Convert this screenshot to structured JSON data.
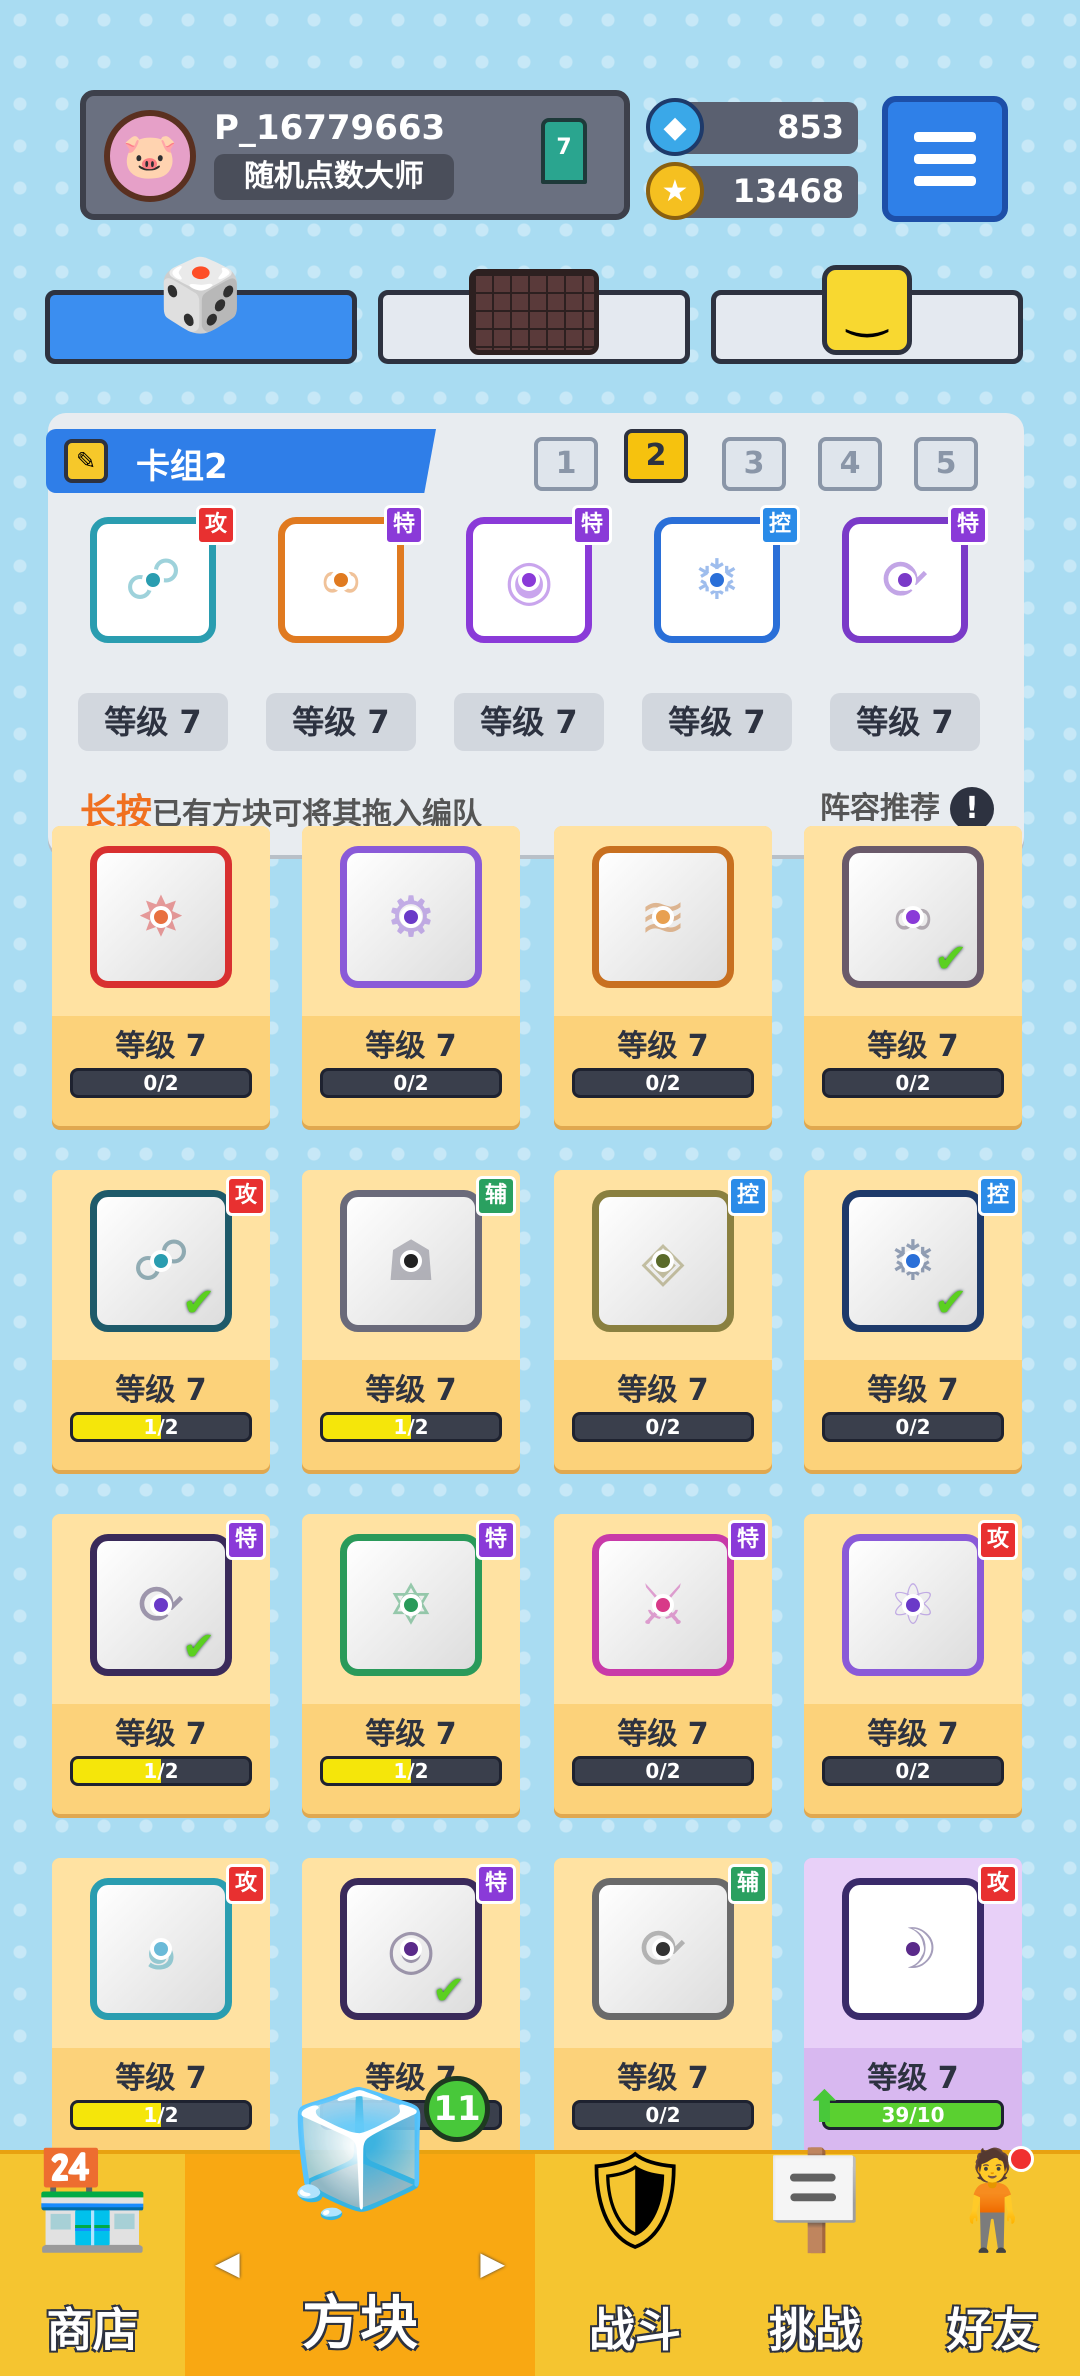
{
  "profile": {
    "name": "P_16779663",
    "title": "随机点数大师",
    "rank": "7"
  },
  "currency": {
    "gems": "853",
    "coins": "13468"
  },
  "deck": {
    "title": "卡组2",
    "numbers": [
      "1",
      "2",
      "3",
      "4",
      "5"
    ],
    "active_index": 1,
    "cards": [
      {
        "tag": "攻",
        "level": "等级 7",
        "color": "#2a9db0",
        "tag_color": "#e83030",
        "sym": "☍"
      },
      {
        "tag": "特",
        "level": "等级 7",
        "color": "#e07a20",
        "tag_color": "#8a3ad8",
        "sym": "∞"
      },
      {
        "tag": "特",
        "level": "等级 7",
        "color": "#8a3ad8",
        "tag_color": "#8a3ad8",
        "sym": "◉"
      },
      {
        "tag": "控",
        "level": "等级 7",
        "color": "#2a6fd8",
        "tag_color": "#2a8be8",
        "sym": "❄"
      },
      {
        "tag": "特",
        "level": "等级 7",
        "color": "#7a3ac8",
        "tag_color": "#8a3ad8",
        "sym": "⟳"
      }
    ],
    "hint_em": "长按",
    "hint_rest": "已有方块可将其拖入编队",
    "recommend": "阵容推荐",
    "recommend_icon": "!"
  },
  "grid": [
    {
      "level": "等级 7",
      "progress": "0/2",
      "ratio": 0,
      "color": "#d83030",
      "tag": "",
      "check": false,
      "sym": "✸",
      "dot": "#e87040"
    },
    {
      "level": "等级 7",
      "progress": "0/2",
      "ratio": 0,
      "color": "#8a5ad8",
      "tag": "",
      "check": false,
      "sym": "⚙",
      "dot": "#6a3ac8"
    },
    {
      "level": "等级 7",
      "progress": "0/2",
      "ratio": 0,
      "color": "#c87020",
      "tag": "",
      "check": false,
      "sym": "≋",
      "dot": "#e8a050"
    },
    {
      "level": "等级 7",
      "progress": "0/2",
      "ratio": 0,
      "color": "#6a5a6a",
      "tag": "",
      "check": true,
      "sym": "∞",
      "dot": "#8a3ad8"
    },
    {
      "level": "等级 7",
      "progress": "1/2",
      "ratio": 0.5,
      "color": "#1e5a6a",
      "tag": "攻",
      "tag_color": "#e83030",
      "check": true,
      "sym": "☍",
      "dot": "#2a9db0"
    },
    {
      "level": "等级 7",
      "progress": "1/2",
      "ratio": 0.5,
      "color": "#6a6a7a",
      "tag": "辅",
      "tag_color": "#2aa060",
      "check": false,
      "sym": "☗",
      "dot": "#222"
    },
    {
      "level": "等级 7",
      "progress": "0/2",
      "ratio": 0,
      "color": "#8a8040",
      "tag": "控",
      "tag_color": "#2a8be8",
      "check": false,
      "sym": "◈",
      "dot": "#5a6a2a"
    },
    {
      "level": "等级 7",
      "progress": "0/2",
      "ratio": 0,
      "color": "#1e3a6a",
      "tag": "控",
      "tag_color": "#2a8be8",
      "check": true,
      "sym": "❄",
      "dot": "#2a6fd8"
    },
    {
      "level": "等级 7",
      "progress": "1/2",
      "ratio": 0.5,
      "color": "#3a2a5a",
      "tag": "特",
      "tag_color": "#8a3ad8",
      "check": true,
      "sym": "⟳",
      "dot": "#6a3ac8"
    },
    {
      "level": "等级 7",
      "progress": "1/2",
      "ratio": 0.5,
      "color": "#2a9a5a",
      "tag": "特",
      "tag_color": "#8a3ad8",
      "check": false,
      "sym": "✡",
      "dot": "#2a9a5a"
    },
    {
      "level": "等级 7",
      "progress": "0/2",
      "ratio": 0,
      "color": "#c83aa8",
      "tag": "特",
      "tag_color": "#8a3ad8",
      "check": false,
      "sym": "⚔",
      "dot": "#d83a88"
    },
    {
      "level": "等级 7",
      "progress": "0/2",
      "ratio": 0,
      "color": "#8a5ad8",
      "tag": "攻",
      "tag_color": "#e83030",
      "check": false,
      "sym": "⚛",
      "dot": "#6a3ac8"
    },
    {
      "level": "等级 7",
      "progress": "1/2",
      "ratio": 0.5,
      "color": "#2a9db0",
      "tag": "攻",
      "tag_color": "#e83030",
      "check": false,
      "sym": "๑",
      "dot": "#6abad8"
    },
    {
      "level": "等级 7",
      "progress": "",
      "ratio": 0,
      "color": "#3a2a5a",
      "tag": "特",
      "tag_color": "#8a3ad8",
      "check": true,
      "sym": "◎",
      "dot": "#5a2a8a"
    },
    {
      "level": "等级 7",
      "progress": "0/2",
      "ratio": 0,
      "color": "#6a6a6a",
      "tag": "辅",
      "tag_color": "#2aa060",
      "check": false,
      "sym": "⟳",
      "dot": "#333"
    },
    {
      "level": "等级 7",
      "progress": "39/10",
      "ratio": 1,
      "color": "#3a2a6a",
      "tag": "攻",
      "tag_color": "#e83030",
      "check": false,
      "sym": "☽",
      "dot": "#5a2a8a",
      "special": true
    }
  ],
  "nav": {
    "shop": "商店",
    "blocks": "方块",
    "battle": "战斗",
    "challenge": "挑战",
    "friends": "好友",
    "blocks_badge": "11"
  }
}
